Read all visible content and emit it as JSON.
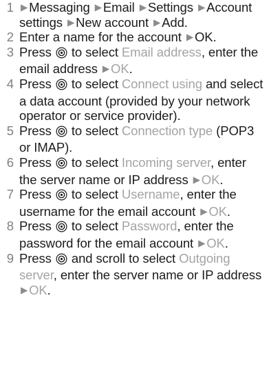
{
  "steps": [
    {
      "number": "1",
      "parts": [
        {
          "t": "arrow"
        },
        {
          "t": "text",
          "v": "Messaging "
        },
        {
          "t": "arrow"
        },
        {
          "t": "text",
          "v": "Email "
        },
        {
          "t": "arrow"
        },
        {
          "t": "text",
          "v": "Settings "
        },
        {
          "t": "arrow"
        },
        {
          "t": "text",
          "v": "Account settings "
        },
        {
          "t": "arrow"
        },
        {
          "t": "text",
          "v": "New account "
        },
        {
          "t": "arrow"
        },
        {
          "t": "text",
          "v": "Add."
        }
      ]
    },
    {
      "number": "2",
      "parts": [
        {
          "t": "text",
          "v": "Enter a name for the account "
        },
        {
          "t": "arrow"
        },
        {
          "t": "text",
          "v": "OK."
        }
      ]
    },
    {
      "number": "3",
      "parts": [
        {
          "t": "text",
          "v": "Press "
        },
        {
          "t": "icon"
        },
        {
          "t": "text",
          "v": " to select "
        },
        {
          "t": "hl",
          "v": "Email address"
        },
        {
          "t": "text",
          "v": ", enter the email address "
        },
        {
          "t": "arrow"
        },
        {
          "t": "hl",
          "v": "OK"
        },
        {
          "t": "text",
          "v": "."
        }
      ]
    },
    {
      "number": "4",
      "parts": [
        {
          "t": "text",
          "v": "Press "
        },
        {
          "t": "icon"
        },
        {
          "t": "text",
          "v": " to select "
        },
        {
          "t": "hl",
          "v": "Connect using"
        },
        {
          "t": "text",
          "v": " and select a data account (provided by your network operator or service provider)."
        }
      ]
    },
    {
      "number": "5",
      "parts": [
        {
          "t": "text",
          "v": "Press "
        },
        {
          "t": "icon"
        },
        {
          "t": "text",
          "v": " to select "
        },
        {
          "t": "hl",
          "v": "Connection type"
        },
        {
          "t": "text",
          "v": " (POP3 or IMAP)."
        }
      ]
    },
    {
      "number": "6",
      "parts": [
        {
          "t": "text",
          "v": "Press "
        },
        {
          "t": "icon"
        },
        {
          "t": "text",
          "v": " to select "
        },
        {
          "t": "hl",
          "v": "Incoming server"
        },
        {
          "t": "text",
          "v": ", enter the server name or IP address "
        },
        {
          "t": "arrow"
        },
        {
          "t": "hl",
          "v": "OK"
        },
        {
          "t": "text",
          "v": "."
        }
      ]
    },
    {
      "number": "7",
      "parts": [
        {
          "t": "text",
          "v": "Press "
        },
        {
          "t": "icon"
        },
        {
          "t": "text",
          "v": " to select "
        },
        {
          "t": "hl",
          "v": "Username"
        },
        {
          "t": "text",
          "v": ", enter the username for the email account "
        },
        {
          "t": "arrow"
        },
        {
          "t": "hl",
          "v": "OK"
        },
        {
          "t": "text",
          "v": "."
        }
      ]
    },
    {
      "number": "8",
      "parts": [
        {
          "t": "text",
          "v": "Press "
        },
        {
          "t": "icon"
        },
        {
          "t": "text",
          "v": " to select "
        },
        {
          "t": "hl",
          "v": "Password"
        },
        {
          "t": "text",
          "v": ", enter the password for the email account "
        },
        {
          "t": "arrow"
        },
        {
          "t": "hl",
          "v": "OK"
        },
        {
          "t": "text",
          "v": "."
        }
      ]
    },
    {
      "number": "9",
      "parts": [
        {
          "t": "text",
          "v": "Press "
        },
        {
          "t": "icon"
        },
        {
          "t": "text",
          "v": " and scroll to select "
        },
        {
          "t": "hl",
          "v": "Outgoing server"
        },
        {
          "t": "text",
          "v": ", enter the server name or IP address "
        },
        {
          "t": "arrow"
        },
        {
          "t": "hl",
          "v": "OK"
        },
        {
          "t": "text",
          "v": "."
        }
      ]
    }
  ],
  "icons": {
    "select_key": "navigation-key-icon",
    "arrow": "arrow-right-icon"
  },
  "colors": {
    "text": "#1c1c1c",
    "highlight": "#a4a4a4",
    "number": "#808080"
  }
}
